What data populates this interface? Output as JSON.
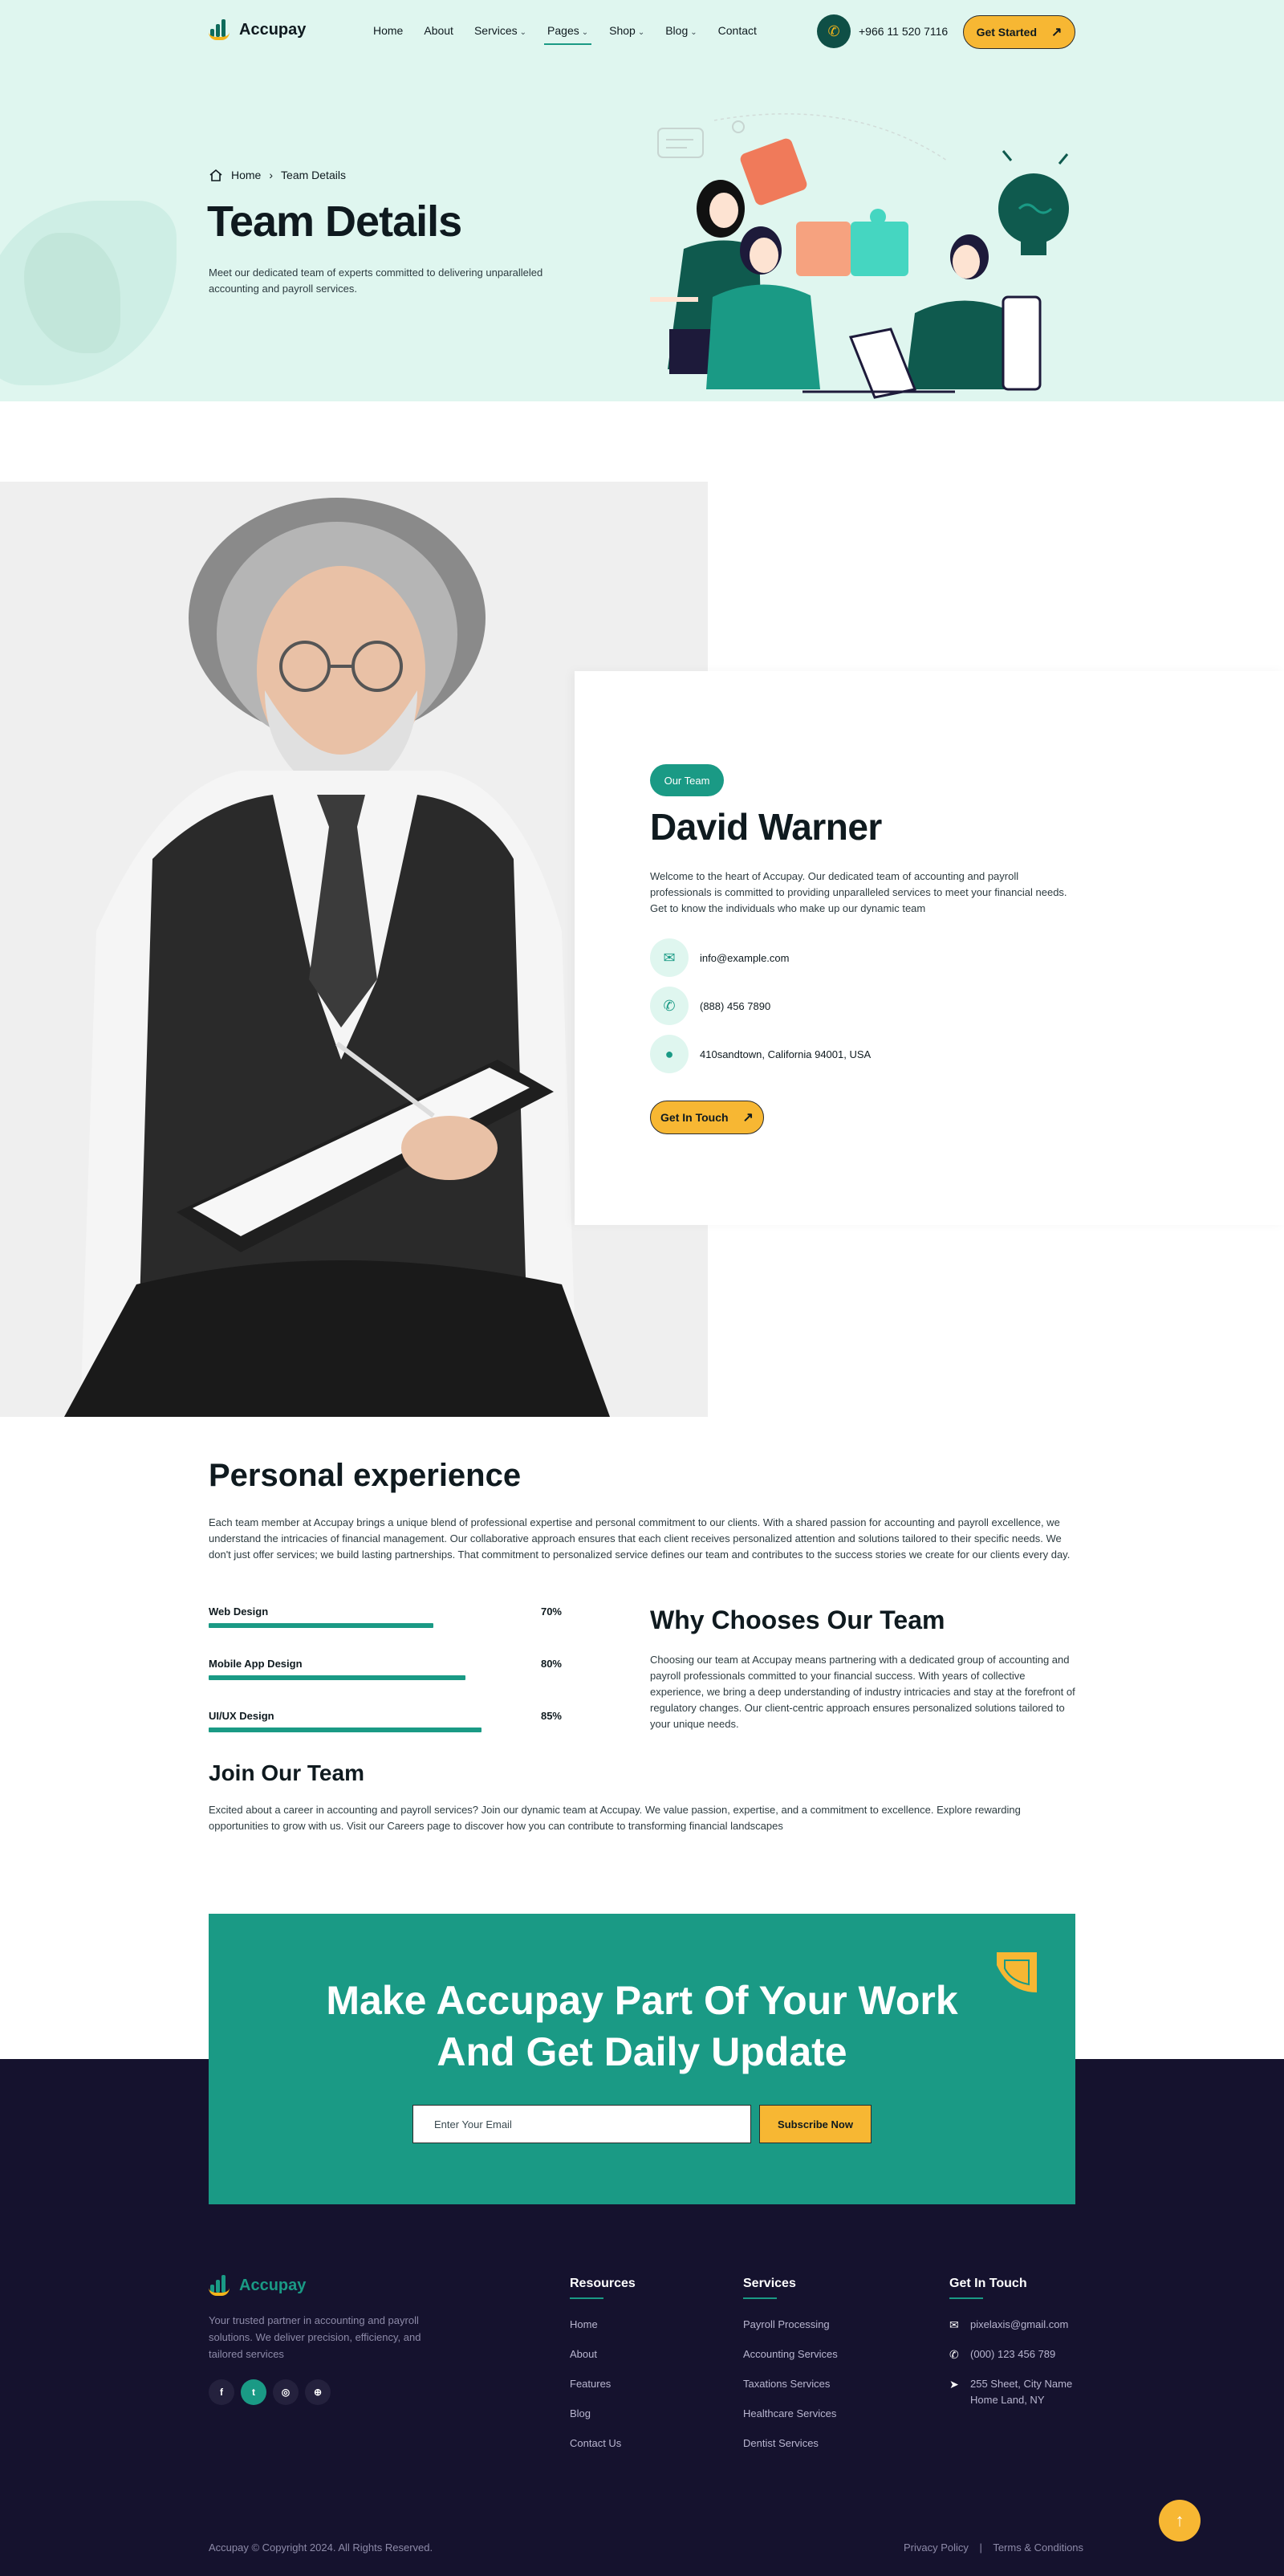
{
  "brand": {
    "name": "Accupay",
    "accent": "#1a9a85",
    "dark": "#15122e",
    "yellow": "#f7b733",
    "hero_bg": "#dff6ef"
  },
  "nav": {
    "items": [
      {
        "label": "Home",
        "has_dropdown": false
      },
      {
        "label": "About",
        "has_dropdown": false
      },
      {
        "label": "Services",
        "has_dropdown": true
      },
      {
        "label": "Pages",
        "has_dropdown": true,
        "active": true
      },
      {
        "label": "Shop",
        "has_dropdown": true
      },
      {
        "label": "Blog",
        "has_dropdown": true
      },
      {
        "label": "Contact",
        "has_dropdown": false
      }
    ],
    "phone": "+966 11 520 7116",
    "cta": "Get Started"
  },
  "hero": {
    "breadcrumb": {
      "home": "Home",
      "current": "Team Details"
    },
    "title": "Team Details",
    "description": "Meet our dedicated team of experts committed to delivering unparalleled accounting and payroll services."
  },
  "profile": {
    "tag": "Our Team",
    "name": "David Warner",
    "bio": "Welcome to the heart of Accupay. Our dedicated team of accounting and payroll professionals is committed to providing unparalleled services to meet your financial needs. Get to know the individuals who make up our dynamic team",
    "email": "info@example.com",
    "phone": "(888) 456 7890",
    "address": "410sandtown, California 94001, USA",
    "cta": "Get In Touch"
  },
  "experience": {
    "title": "Personal experience",
    "text": "Each team member at Accupay brings a unique blend of professional expertise and personal commitment to our clients. With a shared passion for accounting and payroll excellence, we understand the intricacies of financial management. Our collaborative approach ensures that each client receives personalized attention and solutions tailored to their specific needs. We don't just offer services; we build lasting partnerships. That commitment to personalized service defines our team and contributes to the success stories we create for our clients every day.",
    "skills": [
      {
        "label": "Web Design",
        "percent_label": "70%",
        "value": 70
      },
      {
        "label": "Mobile App Design",
        "percent_label": "80%",
        "value": 80
      },
      {
        "label": "UI/UX Design",
        "percent_label": "85%",
        "value": 85
      }
    ],
    "why_title": "Why Chooses Our Team",
    "why_text": "Choosing our team at Accupay means partnering with a dedicated group of accounting and payroll professionals committed to your financial success. With years of collective experience, we bring a deep understanding of industry intricacies and stay at the forefront of regulatory changes. Our client-centric approach ensures personalized solutions tailored to your unique needs.",
    "join_title": "Join Our Team",
    "join_text": "Excited about a career in accounting and payroll services? Join our dynamic team at Accupay. We value passion, expertise, and a commitment to excellence. Explore rewarding opportunities to grow with us. Visit our Careers page to discover how you can contribute to transforming financial landscapes"
  },
  "newsletter": {
    "title_line1": "Make Accupay Part Of Your Work",
    "title_line2": "And Get Daily Update",
    "placeholder": "Enter Your Email",
    "button": "Subscribe Now"
  },
  "footer": {
    "about": "Your trusted partner in accounting and payroll solutions. We deliver precision, efficiency, and tailored services",
    "socials": [
      {
        "icon": "facebook-icon",
        "glyph": "f"
      },
      {
        "icon": "twitter-icon",
        "glyph": "t"
      },
      {
        "icon": "instagram-icon",
        "glyph": "◎"
      },
      {
        "icon": "dribbble-icon",
        "glyph": "⊕"
      }
    ],
    "resources": {
      "title": "Resources",
      "links": [
        "Home",
        "About",
        "Features",
        "Blog",
        "Contact Us"
      ]
    },
    "services": {
      "title": "Services",
      "links": [
        "Payroll Processing",
        "Accounting Services",
        "Taxations Services",
        "Healthcare Services",
        "Dentist Services"
      ]
    },
    "contact": {
      "title": "Get In Touch",
      "email": "pixelaxis@gmail.com",
      "phone": "(000) 123 456 789",
      "address_line1": "255 Sheet, City Name",
      "address_line2": "Home Land, NY"
    },
    "copyright": "Accupay © Copyright 2024. All Rights Reserved.",
    "privacy": "Privacy Policy",
    "sep": "|",
    "terms": "Terms & Conditions"
  }
}
